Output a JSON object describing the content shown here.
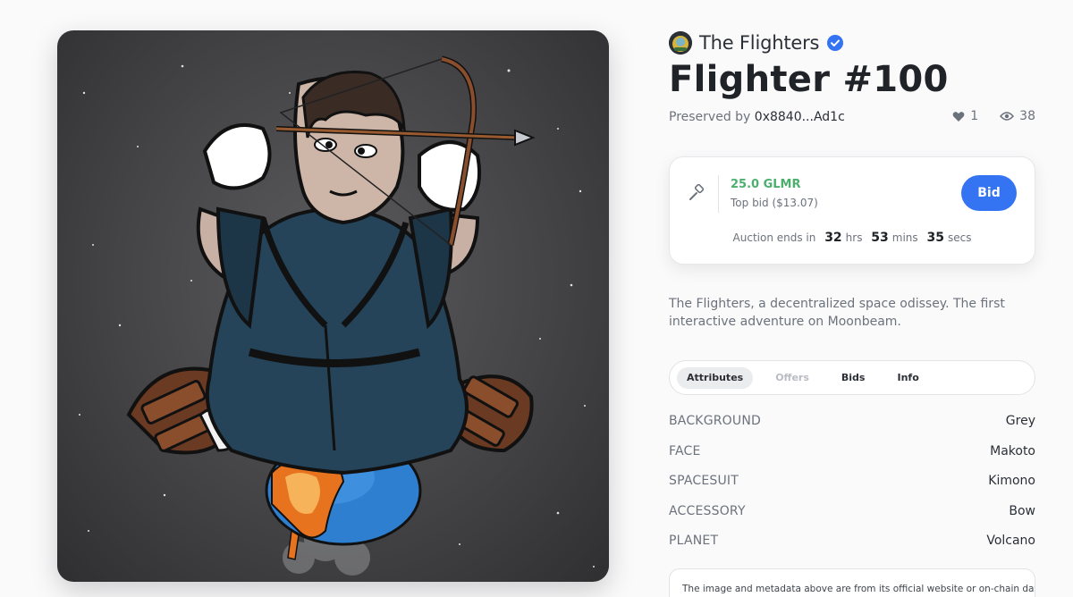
{
  "collection": {
    "name": "The Flighters",
    "verified_icon": "verified-check-icon"
  },
  "nft": {
    "title": "Flighter #100",
    "preserved_prefix": "Preserved by",
    "owner": "0x8840...Ad1c",
    "likes": "1",
    "views": "38",
    "description": "The Flighters, a decentralized space odissey. The first interactive adventure on Moonbeam."
  },
  "auction": {
    "top_bid": "25.0 GLMR",
    "top_bid_sub": "Top bid ($13.07)",
    "bid_label": "Bid",
    "ends_label": "Auction ends in",
    "hours": "32",
    "hours_unit": "hrs",
    "minutes": "53",
    "minutes_unit": "mins",
    "seconds": "35",
    "seconds_unit": "secs"
  },
  "tabs": [
    {
      "label": "Attributes",
      "state": "active"
    },
    {
      "label": "Offers",
      "state": "disabled"
    },
    {
      "label": "Bids",
      "state": "normal"
    },
    {
      "label": "Info",
      "state": "normal"
    }
  ],
  "attributes": [
    {
      "key": "BACKGROUND",
      "value": "Grey"
    },
    {
      "key": "FACE",
      "value": "Makoto"
    },
    {
      "key": "SPACESUIT",
      "value": "Kimono"
    },
    {
      "key": "ACCESSORY",
      "value": "Bow"
    },
    {
      "key": "PLANET",
      "value": "Volcano"
    }
  ],
  "disclaimer": "The image and metadata above are from its official website or on-chain data,",
  "colors": {
    "accent": "#3474f2",
    "bid_green": "#4caf6e",
    "muted_text": "#6c727c",
    "artwork_bg": "#444446"
  }
}
